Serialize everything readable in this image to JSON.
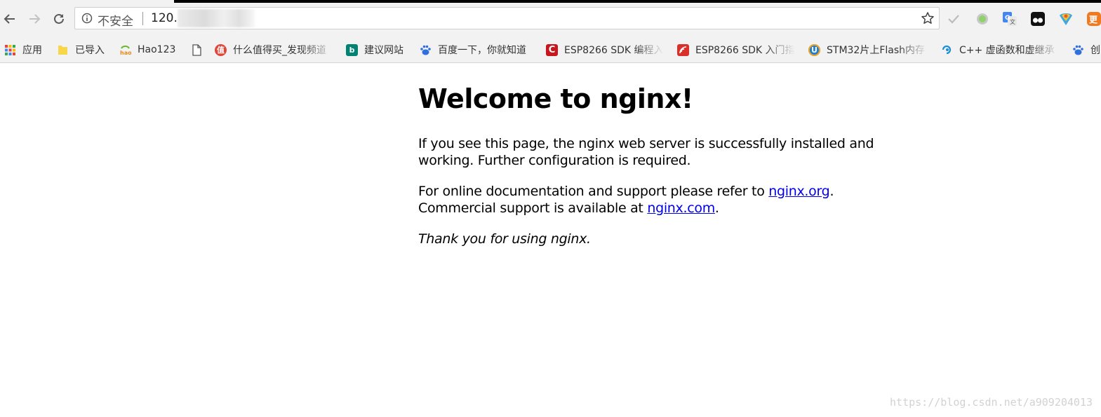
{
  "browser": {
    "security_label": "不安全",
    "url_visible": "120.",
    "bookmarks": [
      {
        "label": "应用",
        "icon": "apps-grid-icon"
      },
      {
        "label": "已导入",
        "icon": "folder-icon"
      },
      {
        "label": "Hao123",
        "icon": "hao123-icon"
      },
      {
        "label": "什么值得买_发现频道",
        "icon": "smzdm-icon"
      },
      {
        "label": "建议网站",
        "icon": "bing-icon"
      },
      {
        "label": "百度一下，你就知道",
        "icon": "baidu-paw-icon"
      },
      {
        "label": "ESP8266 SDK 编程入",
        "icon": "csdn-icon"
      },
      {
        "label": "ESP8266 SDK 入门指",
        "icon": "espressif-icon"
      },
      {
        "label": "STM32片上Flash内存",
        "icon": "blog-icon"
      },
      {
        "label": "C++ 虚函数和虚继承",
        "icon": "swirl-icon"
      },
      {
        "label": "创",
        "icon": "baidu-paw-icon"
      }
    ],
    "colors": {
      "toolbar_bg": "#f2f2f2",
      "link": "#0000ee",
      "topline": "#000000"
    }
  },
  "page": {
    "heading": "Welcome to nginx!",
    "p1_line1": "If you see this page, the nginx web server is successfully installed and",
    "p1_line2": "working. Further configuration is required.",
    "p2_line1_prefix": "For online documentation and support please refer to ",
    "p2_link1": "nginx.org",
    "p2_line1_suffix": ".",
    "p2_line2_prefix": "Commercial support is available at ",
    "p2_link2": "nginx.com",
    "p2_line2_suffix": ".",
    "thanks": "Thank you for using nginx."
  },
  "watermark": "https://blog.csdn.net/a909204013"
}
